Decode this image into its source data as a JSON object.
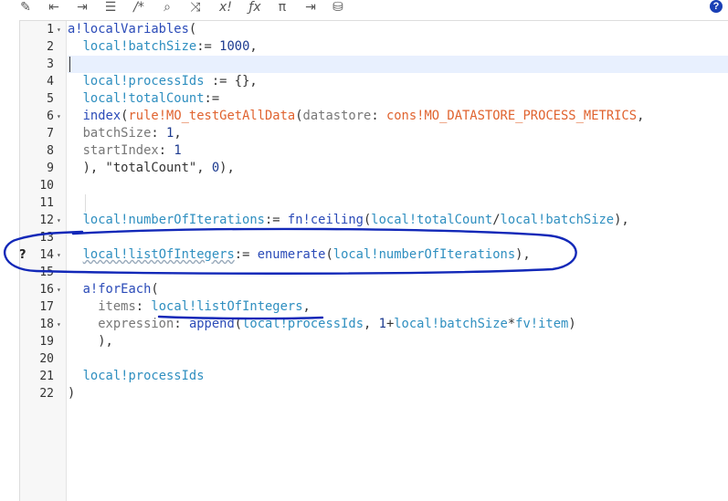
{
  "toolbar": {
    "icons": [
      {
        "name": "magic-wand-icon",
        "glyph": "✎"
      },
      {
        "name": "outdent-icon",
        "glyph": "⇤"
      },
      {
        "name": "indent-icon",
        "glyph": "⇥"
      },
      {
        "name": "list-icon",
        "glyph": "☰"
      },
      {
        "name": "comment-icon",
        "glyph": "/*"
      },
      {
        "name": "search-icon",
        "glyph": "⌕"
      },
      {
        "name": "shuffle-icon",
        "glyph": "⤨"
      },
      {
        "name": "x-factorial-icon",
        "glyph": "x!"
      },
      {
        "name": "fx-icon",
        "glyph": "ƒx"
      },
      {
        "name": "pi-icon",
        "glyph": "π"
      },
      {
        "name": "export-icon",
        "glyph": "⇥"
      },
      {
        "name": "database-search-icon",
        "glyph": "⛁"
      }
    ],
    "help_label": "?"
  },
  "editor": {
    "lines": [
      {
        "n": "1",
        "fold": "▾"
      },
      {
        "n": "2",
        "fold": ""
      },
      {
        "n": "3",
        "fold": ""
      },
      {
        "n": "4",
        "fold": ""
      },
      {
        "n": "5",
        "fold": ""
      },
      {
        "n": "6",
        "fold": "▾"
      },
      {
        "n": "7",
        "fold": ""
      },
      {
        "n": "8",
        "fold": ""
      },
      {
        "n": "9",
        "fold": ""
      },
      {
        "n": "10",
        "fold": ""
      },
      {
        "n": "11",
        "fold": ""
      },
      {
        "n": "12",
        "fold": "▾"
      },
      {
        "n": "13",
        "fold": ""
      },
      {
        "n": "14",
        "fold": "▾"
      },
      {
        "n": "15",
        "fold": ""
      },
      {
        "n": "16",
        "fold": "▾"
      },
      {
        "n": "17",
        "fold": ""
      },
      {
        "n": "18",
        "fold": "▾"
      },
      {
        "n": "19",
        "fold": ""
      },
      {
        "n": "20",
        "fold": ""
      },
      {
        "n": "21",
        "fold": ""
      },
      {
        "n": "22",
        "fold": ""
      }
    ],
    "code": {
      "l1": {
        "a": "a!localVariables",
        "b": "("
      },
      "l2": {
        "a": "local!batchSize",
        "b": ":= ",
        "c": "1000",
        "d": ","
      },
      "l4": {
        "a": "local!processIds",
        "b": " := {},"
      },
      "l5": {
        "a": "local!totalCount",
        "b": ":="
      },
      "l6": {
        "a": "index",
        "b": "(",
        "c": "rule!MO_testGetAllData",
        "d": "(",
        "e": "datastore",
        "f": ": ",
        "g": "cons!MO_DATASTORE_PROCESS_METRICS",
        "h": ","
      },
      "l7": {
        "a": "batchSize",
        "b": ": ",
        "c": "1",
        "d": ","
      },
      "l8": {
        "a": "startIndex",
        "b": ": ",
        "c": "1"
      },
      "l9": {
        "a": "), ",
        "b": "\"totalCount\"",
        "c": ", ",
        "d": "0",
        "e": "),"
      },
      "l12": {
        "a": "local!numberOfIterations",
        "b": ":= ",
        "c": "fn!ceiling",
        "d": "(",
        "e": "local!totalCount",
        "f": "/",
        "g": "local!batchSize",
        "h": "),"
      },
      "l14": {
        "a": "local!listOfIntegers",
        "b": ":= ",
        "c": "enumerate",
        "d": "(",
        "e": "local!numberOfIterations",
        "f": "),"
      },
      "l16": {
        "a": "a!forEach",
        "b": "("
      },
      "l17": {
        "a": "items",
        "b": ": ",
        "c": "local!listOfIntegers",
        "d": ","
      },
      "l18": {
        "a": "expression",
        "b": ": ",
        "c": "append",
        "d": "(",
        "e": "local!processIds",
        "f": ", ",
        "g": "1",
        "h": "+",
        "i": "local!batchSize",
        "j": "*",
        "k": "fv!item",
        "l": ")"
      },
      "l19": {
        "a": "),"
      },
      "l21": {
        "a": "local!processIds"
      },
      "l22": {
        "a": ")"
      }
    },
    "hint_glyph": "?"
  },
  "colors": {
    "keyword": "#2b4bb8",
    "variable": "#2f8fc0",
    "rule": "#e0632f",
    "annotation": "#1228b8"
  }
}
